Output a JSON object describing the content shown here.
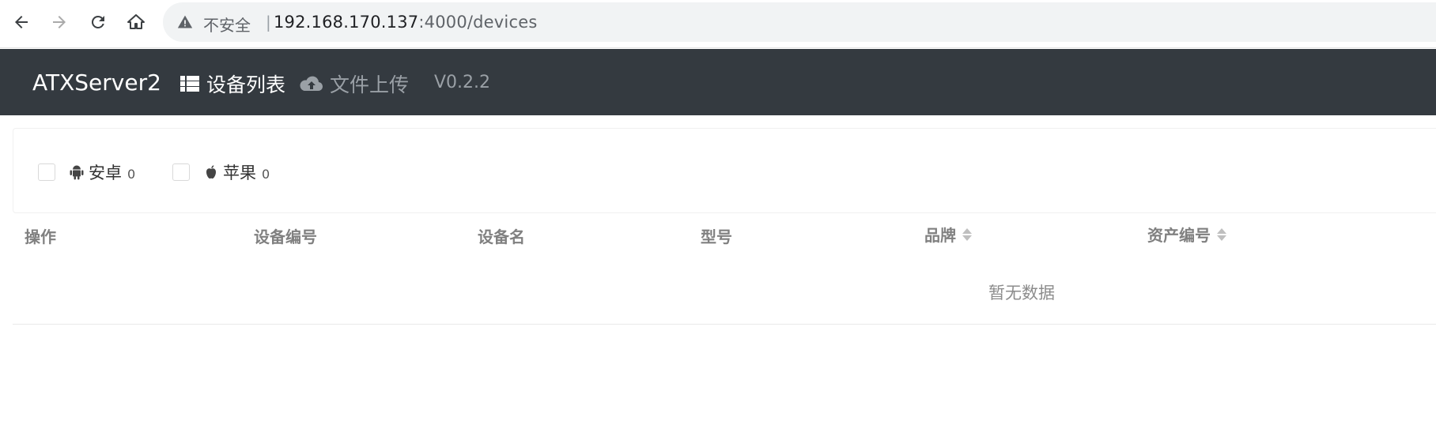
{
  "browser": {
    "security_label": "不安全",
    "separator": "|",
    "url_host": "192.168.170.137",
    "url_rest": ":4000/devices"
  },
  "navbar": {
    "brand": "ATXServer2",
    "items": [
      {
        "label": "设备列表",
        "icon": "list-icon",
        "active": true
      },
      {
        "label": "文件上传",
        "icon": "cloud-upload-icon",
        "active": false
      }
    ],
    "version": "V0.2.2"
  },
  "filters": [
    {
      "label": "安卓",
      "count": "0",
      "icon": "android-icon",
      "checked": false
    },
    {
      "label": "苹果",
      "count": "0",
      "icon": "apple-icon",
      "checked": false
    }
  ],
  "table": {
    "columns": [
      {
        "label": "操作",
        "sortable": false
      },
      {
        "label": "设备编号",
        "sortable": false
      },
      {
        "label": "设备名",
        "sortable": false
      },
      {
        "label": "型号",
        "sortable": false
      },
      {
        "label": "品牌",
        "sortable": true
      },
      {
        "label": "资产编号",
        "sortable": true
      }
    ],
    "empty_text": "暂无数据"
  },
  "colors": {
    "navbar_bg": "#343a40",
    "addressbar_bg": "#f1f3f4"
  }
}
